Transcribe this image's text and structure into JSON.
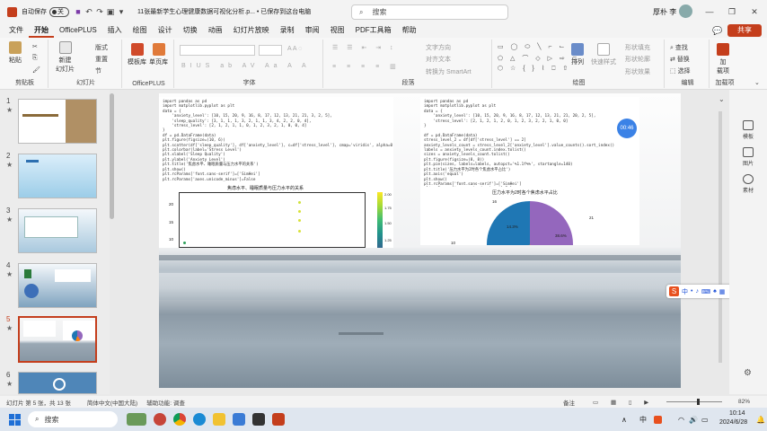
{
  "titlebar": {
    "autosave_label": "自动保存",
    "autosave_state": "关",
    "doc_title": "11张最新学生心理健康数据可视化分析.p... • 已保存到这台电脑",
    "search_placeholder": "搜索",
    "user_name": "厚朴 李"
  },
  "menu": {
    "tabs": [
      "文件",
      "开始",
      "OfficePLUS",
      "插入",
      "绘图",
      "设计",
      "切换",
      "动画",
      "幻灯片放映",
      "录制",
      "审阅",
      "视图",
      "PDF工具箱",
      "帮助"
    ],
    "active_tab": "开始",
    "share_label": "共享"
  },
  "ribbon": {
    "paste": "粘贴",
    "clipboard_group": "剪贴板",
    "new_slide": "新建\n幻灯片",
    "layout": "版式",
    "reset": "重置",
    "section": "节",
    "slides_group": "幻灯片",
    "template_lib": "模板库",
    "single_page_lib": "单页库",
    "officeplus_group": "OfficePLUS",
    "font_group": "字体",
    "text_direction": "文字方向",
    "align_text": "对齐文本",
    "convert_smartart": "转换为 SmartArt",
    "paragraph_group": "段落",
    "arrange": "排列",
    "quick_styles": "快速样式",
    "shape_fill": "形状填充",
    "shape_outline": "形状轮廓",
    "shape_effects": "形状效果",
    "drawing_group": "绘图",
    "find": "查找",
    "replace": "替换",
    "select": "选择",
    "editing_group": "编辑",
    "addin": "加\n载项",
    "addin_group": "加载项"
  },
  "slides": [
    {
      "num": "1",
      "star": "★"
    },
    {
      "num": "2",
      "star": "★"
    },
    {
      "num": "3",
      "star": "★"
    },
    {
      "num": "4",
      "star": "★"
    },
    {
      "num": "5",
      "star": "★"
    },
    {
      "num": "6",
      "star": "★"
    }
  ],
  "slide5": {
    "code_left": "import pandas as pd\nimport matplotlib.pyplot as plt\ndata = {\n    'anxiety_level': [10, 15, 20, 9, 16, 8, 17, 12, 13, 21, 21, 3, 2, 5],\n    'sleep_quality': [3, 1, 1, 1, 3, 2, 1, 1, 3, 4, 2, 2, 0, 4],\n    'stress_level': [2, 1, 2, 1, 1, 0, 1, 2, 3, 2, 1, 0, 0, 4]\n}\ndf = pd.DataFrame(data)\nplt.figure(figsize=(10, 6))\nplt.scatter(df['sleep_quality'], df['anxiety_level'], c=df['stress_level'], cmap='viridis', alpha=0.7)\nplt.colorbar(label='Stress Level')\nplt.xlabel('Sleep Quality')\nplt.ylabel('Anxiety Level')\nplt.title('焦虑水平、睡眠质量与压力水平的关系')\nplt.show()\nplt.rcParams['font.sans-serif']=['SimHei']\nplt.rcParams['axes.unicode_minus']=False",
    "code_right": "import pandas as pd\nimport matplotlib.pyplot as plt\ndata = {\n    'anxiety_level': [10, 15, 20, 9, 16, 8, 17, 12, 13, 21, 21, 20, 2, 5],\n    'stress_level': [2, 1, 2, 1, 2, 0, 1, 2, 3, 2, 2, 1, 0, 0]\n}\n\ndf = pd.DataFrame(data)\nstress_level_2 = df[df['stress_level'] == 2]\nanxiety_levels_count = stress_level_2['anxiety_level'].value_counts().sort_index()\nlabels = anxiety_levels_count.index.tolist()\nsizes = anxiety_levels_count.tolist()\nplt.figure(figsize=(8, 8))\nplt.pie(sizes, labels=labels, autopct='%1.1f%%', startangle=140)\nplt.title('压力水平为2时各个焦虑水平占比')\nplt.axis('equal')\nplt.show()\nplt.rcParams['font.sans-serif']=['SimHei']\nplt.rcParams['axes.unicode_minus']=False",
    "scatter_title": "焦虑水平、睡眠质量与压力水平的关系",
    "scatter_yticks": [
      "20",
      "15",
      "10"
    ],
    "colorbar_ticks": [
      "2.00",
      "1.75",
      "1.50",
      "1.25"
    ],
    "pie_title": "压力水平为2时各个焦虑水平占比",
    "pie_labels": [
      "16",
      "21",
      "10"
    ],
    "pie_pcts": [
      "14.3%",
      "38.6%"
    ],
    "timer": "00:46"
  },
  "rightpanel": {
    "items": [
      "模板",
      "图片",
      "素材"
    ]
  },
  "status": {
    "slide_info": "幻灯片 第 5 张，共 13 张",
    "language": "简体中文(中国大陆)",
    "accessibility": "辅助功能: 调查",
    "notes": "备注",
    "zoom": "82%"
  },
  "taskbar": {
    "search": "搜索",
    "lang": "中",
    "time": "10:14",
    "date": "2024/6/28"
  },
  "ime": {
    "items": [
      "中",
      "•",
      "♪"
    ]
  },
  "colors": {
    "accent": "#c43e1c",
    "pie_blue": "#1f77b4",
    "pie_orange": "#ff7f0e",
    "pie_purple": "#9467bd"
  }
}
